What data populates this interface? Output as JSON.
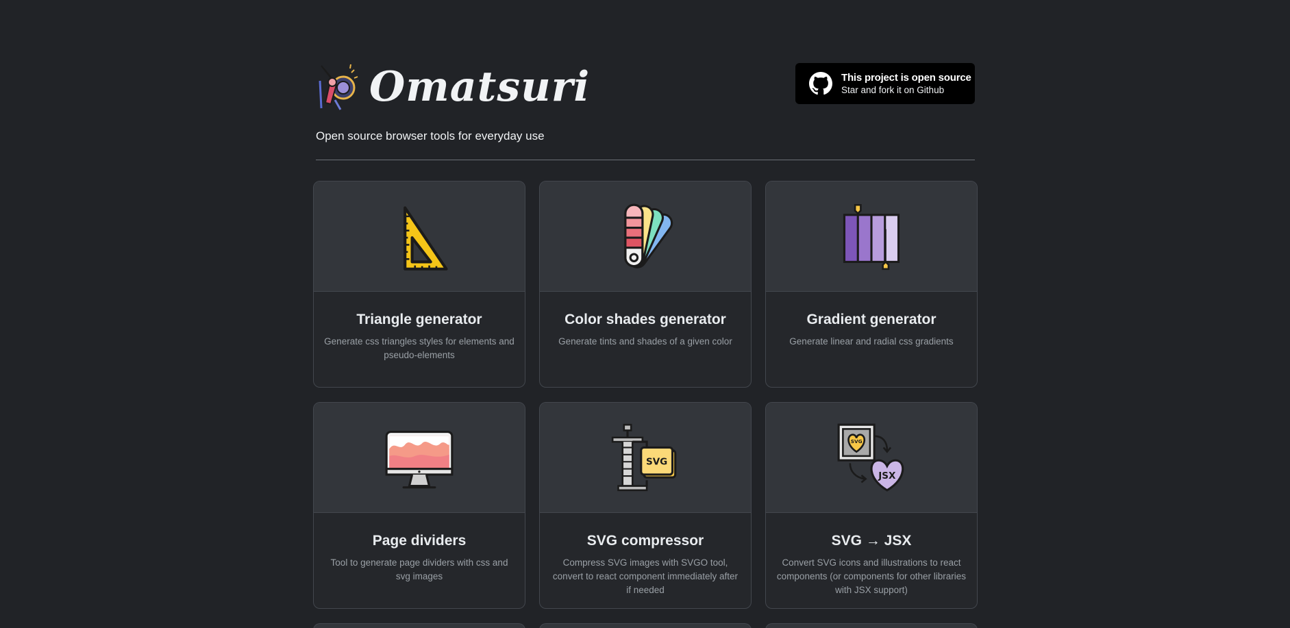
{
  "header": {
    "brand": "Omatsuri",
    "tagline": "Open source browser tools for everyday use",
    "github_badge": {
      "title": "This project is open source",
      "subtitle": "Star and fork it on Github"
    }
  },
  "tools": [
    {
      "title": "Triangle generator",
      "description": "Generate css triangles styles for elements and pseudo-elements",
      "icon": "triangle-ruler-icon"
    },
    {
      "title": "Color shades generator",
      "description": "Generate tints and shades of a given color",
      "icon": "color-swatch-fan-icon"
    },
    {
      "title": "Gradient generator",
      "description": "Generate linear and radial css gradients",
      "icon": "gradient-bars-icon"
    },
    {
      "title": "Page dividers",
      "description": "Tool to generate page dividers with css and svg images",
      "icon": "monitor-wave-icon"
    },
    {
      "title": "SVG compressor",
      "description": "Compress SVG images with SVGO tool, convert to react component immediately after if needed",
      "icon": "svg-clamp-icon"
    },
    {
      "title": "SVG → JSX",
      "description": "Convert SVG icons and illustrations to react components (or components for other libraries with JSX support)",
      "icon": "svg-to-jsx-icon"
    }
  ],
  "icon_labels": {
    "svg": "SVG",
    "jsx": "JSX"
  },
  "colors": {
    "background": "#212327",
    "card_background": "#25272b",
    "card_media": "#33363b",
    "card_border": "#43474e",
    "badge_background": "#000000"
  }
}
